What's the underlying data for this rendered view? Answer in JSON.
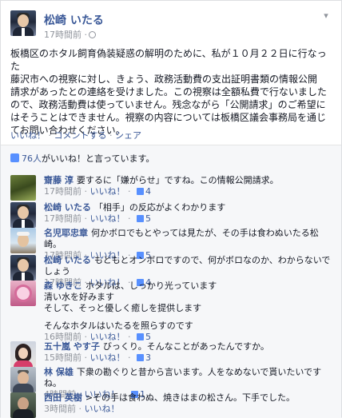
{
  "post": {
    "author": "松崎 いたる",
    "time": "17時間前 ·",
    "body_lines": [
      "板橋区のホタル飼育偽装疑惑の解明のために、私が１０月２２日に行なった",
      "藤沢市への視察に対し、きょう、政務活動費の支出証明書類の情報公開",
      "請求があったとの連絡を受けました。この視察は全額私費で行ないました",
      "ので、政務活動費は使っていません。残念ながら「公開請求」のご希望に",
      "はそうことはできません。視察の内容については板橋区議会事務局を通じ",
      "てお問い合わせください。"
    ],
    "actions": [
      "いいね！",
      "コメントする",
      "シェア"
    ],
    "action_sep": " · "
  },
  "likes": {
    "count": "76人",
    "suffix": "がいいね！と言っています。"
  },
  "comments": [
    {
      "author": "齋藤 淳",
      "lines": [
        "要するに「嫌がらせ」ですね。この情報公開請求。"
      ],
      "time": "17時間前",
      "like_label": "いいね！",
      "likes": "4",
      "avatar": "forest"
    },
    {
      "author": "松崎 いたる",
      "lines": [
        "「相手」の反応がよくわかります"
      ],
      "time": "17時間前",
      "like_label": "いいね！",
      "likes": "5",
      "avatar": "author"
    },
    {
      "author": "名児耶忠章",
      "lines": [
        "何かボロでもとやっては見たが、その手は食わぬいたる松崎。"
      ],
      "time": "17時間前",
      "like_label": "いいね！",
      "likes": "5",
      "avatar": "elder"
    },
    {
      "author": "松崎 いたる",
      "lines": [
        "もともとオンボロですので、何がボロなのか、わからないでしょう"
      ],
      "time": "17時間前",
      "like_label": "いいね！",
      "likes": "4",
      "avatar": "author"
    },
    {
      "author": "森 ゆきこ",
      "lines": [
        "ホタルは、しっかり光っています",
        "清い水を好みます",
        "そして、そっと優しく癒しを提供します",
        "",
        "そんなホタルはいたるを照らすのです"
      ],
      "time": "16時間前",
      "like_label": "いいね！",
      "likes": "5",
      "avatar": "pink"
    },
    {
      "author": "五十嵐 やす子",
      "lines": [
        "びっくり。そんなことがあったんですか。"
      ],
      "time": "15時間前",
      "like_label": "いいね！",
      "likes": "3",
      "avatar": "woman"
    },
    {
      "author": "林 保雄",
      "lines": [
        "下衆の勘ぐりと昔から言います。人をなめないで貰いたいですね。"
      ],
      "time": "4時間前",
      "like_label": "いいね！",
      "likes": "1",
      "avatar": "man2"
    },
    {
      "author": "西田 英樹",
      "lines": [
        ">その手は食わぬ、焼きはまの松さん。下手でした。"
      ],
      "time": "3時間前",
      "like_label": "いいね！",
      "likes": "",
      "avatar": "man3"
    }
  ],
  "colors": {
    "link": "#3b5998",
    "meta": "#90949c",
    "like_blue": "#5890ff",
    "comments_bg": "#f6f7f9"
  }
}
